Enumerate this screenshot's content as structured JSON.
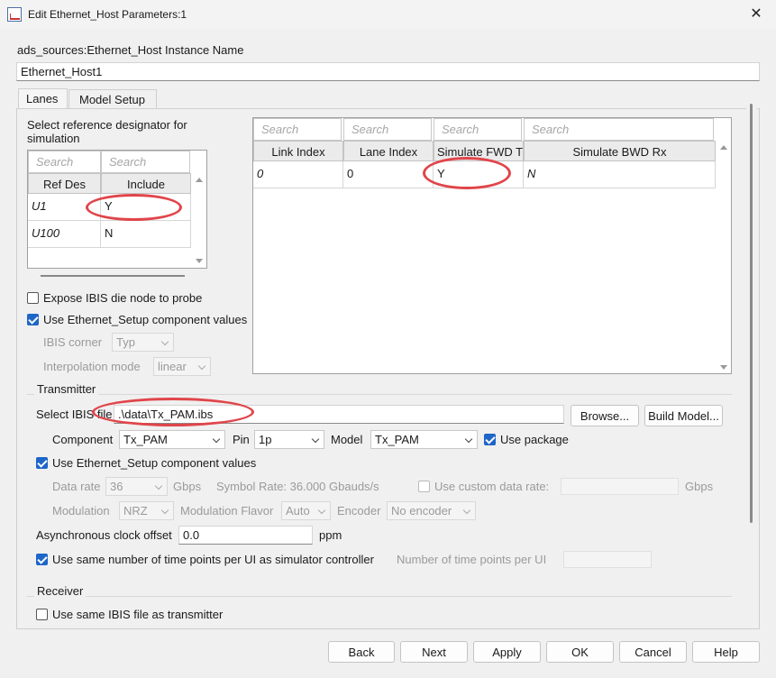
{
  "window": {
    "title": "Edit Ethernet_Host Parameters:1"
  },
  "instance": {
    "label": "ads_sources:Ethernet_Host Instance Name",
    "value": "Ethernet_Host1"
  },
  "tabs": [
    {
      "label": "Lanes"
    },
    {
      "label": "Model Setup"
    }
  ],
  "refdes": {
    "label": "Select reference designator for simulation",
    "search_placeholder": "Search",
    "columns": [
      "Ref Des",
      "Include"
    ],
    "rows": [
      {
        "ref": "U1",
        "include": "Y"
      },
      {
        "ref": "U100",
        "include": "N"
      }
    ]
  },
  "lanes_table": {
    "search_placeholder": "Search",
    "columns": [
      "Link Index",
      "Lane Index",
      "Simulate FWD Tx",
      "Simulate BWD Rx"
    ],
    "rows": [
      {
        "link": "0",
        "lane": "0",
        "fwd": "Y",
        "bwd": "N"
      }
    ]
  },
  "options": {
    "expose_probe": "Expose IBIS die node to probe",
    "use_setup": "Use Ethernet_Setup component values",
    "ibis_corner_label": "IBIS corner",
    "ibis_corner_value": "Typ",
    "interp_label": "Interpolation mode",
    "interp_value": "linear"
  },
  "transmitter": {
    "group": "Transmitter",
    "ibis_label": "Select IBIS file",
    "ibis_value": ".\\data\\Tx_PAM.ibs",
    "browse": "Browse...",
    "build_model": "Build Model...",
    "component_label": "Component",
    "component_value": "Tx_PAM",
    "pin_label": "Pin",
    "pin_value": "1p",
    "model_label": "Model",
    "model_value": "Tx_PAM",
    "use_package": "Use package",
    "use_setup": "Use Ethernet_Setup component values",
    "data_rate_label": "Data rate",
    "data_rate_value": "36",
    "gbps": "Gbps",
    "symbol_rate": "Symbol Rate: 36.000 Gbauds/s",
    "custom_rate": "Use custom data rate:",
    "gbps2": "Gbps",
    "modulation_label": "Modulation",
    "modulation_value": "NRZ",
    "flavor_label": "Modulation Flavor",
    "flavor_value": "Auto",
    "encoder_label": "Encoder",
    "encoder_value": "No encoder",
    "async_label": "Asynchronous clock offset",
    "async_value": "0.0",
    "ppm": "ppm",
    "same_points": "Use same number of time points per UI as simulator controller",
    "num_points_label": "Number of time points per UI"
  },
  "receiver": {
    "group": "Receiver",
    "same_ibis": "Use same IBIS file as transmitter"
  },
  "buttons": {
    "back": "Back",
    "next": "Next",
    "apply": "Apply",
    "ok": "OK",
    "cancel": "Cancel",
    "help": "Help"
  },
  "colors": {
    "accent": "#1e66c8",
    "annotation": "#e0454a"
  }
}
